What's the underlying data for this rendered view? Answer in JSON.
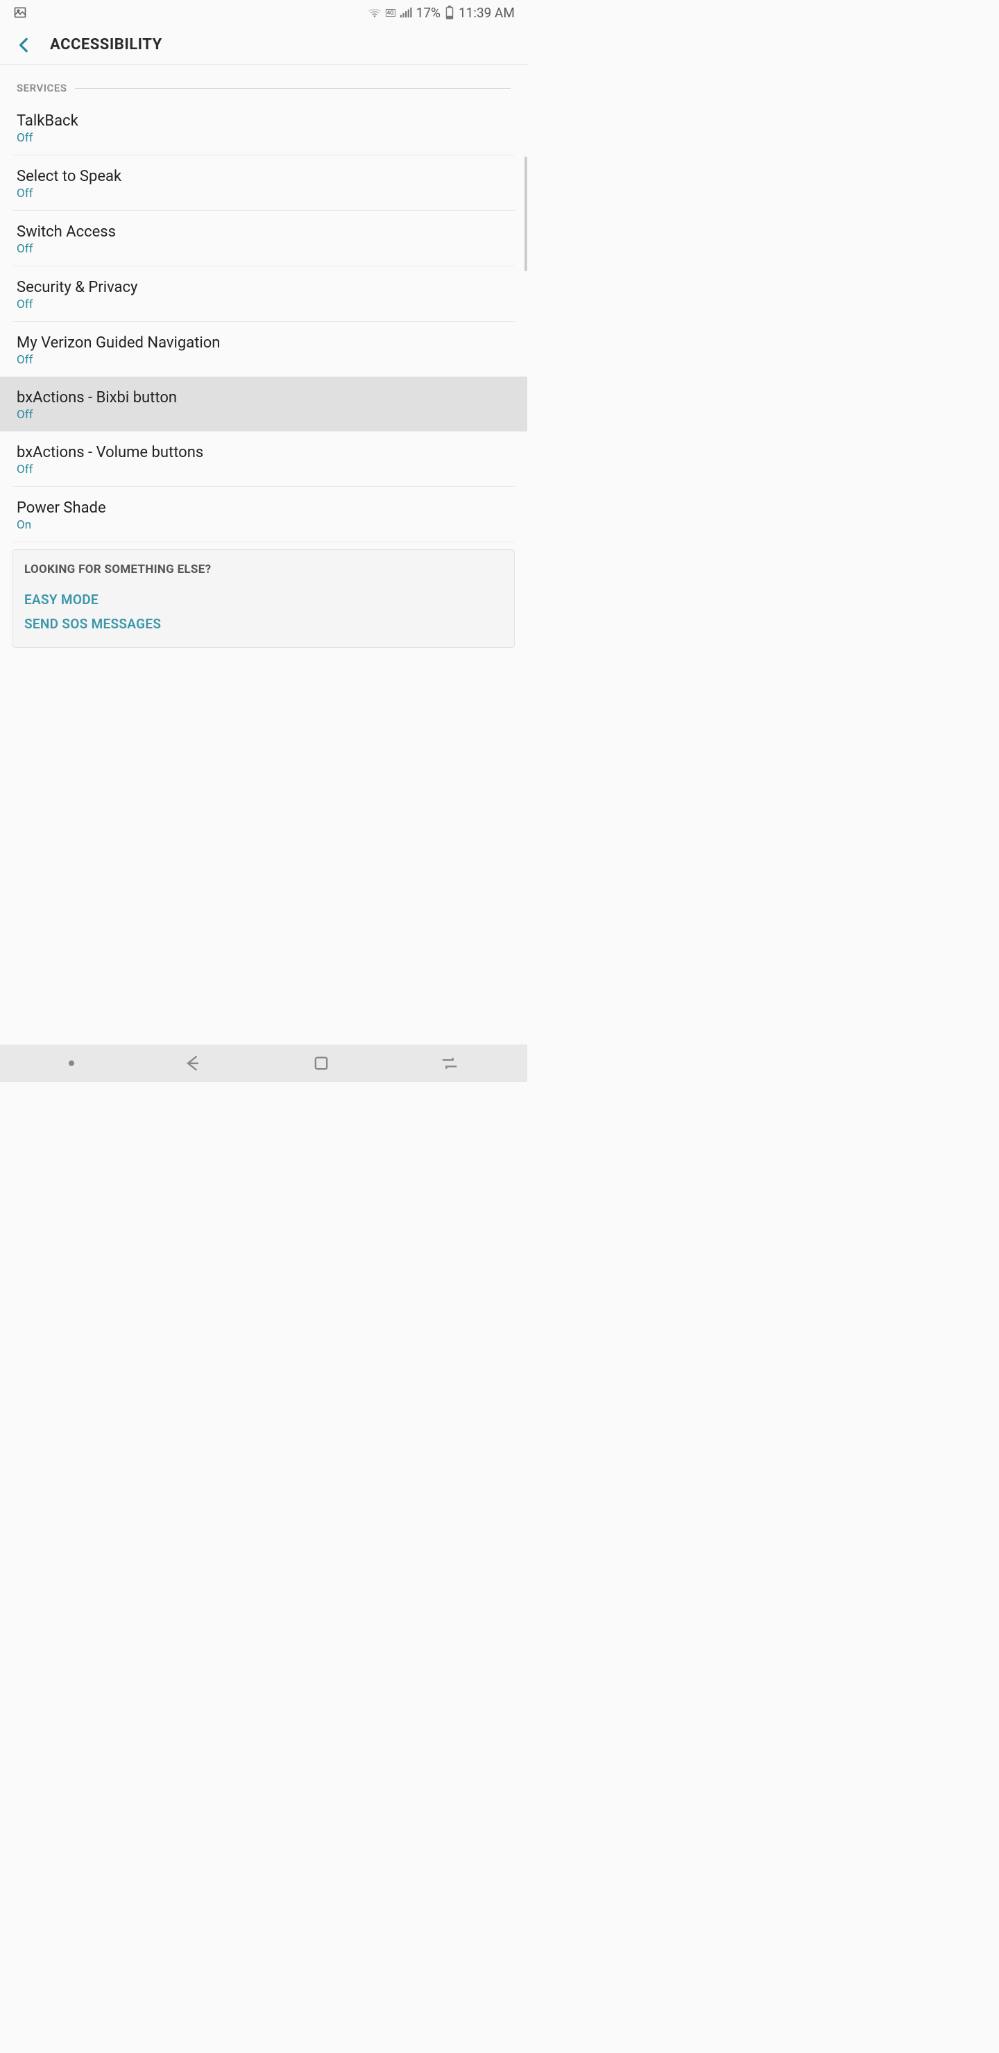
{
  "status": {
    "battery_pct": "17%",
    "time": "11:39 AM"
  },
  "header": {
    "title": "ACCESSIBILITY"
  },
  "section": {
    "label": "SERVICES"
  },
  "items": [
    {
      "title": "TalkBack",
      "status": "Off",
      "highlighted": false
    },
    {
      "title": "Select to Speak",
      "status": "Off",
      "highlighted": false
    },
    {
      "title": "Switch Access",
      "status": "Off",
      "highlighted": false
    },
    {
      "title": "Security & Privacy",
      "status": "Off",
      "highlighted": false
    },
    {
      "title": "My Verizon Guided Navigation",
      "status": "Off",
      "highlighted": false
    },
    {
      "title": "bxActions - Bixbi button",
      "status": "Off",
      "highlighted": true
    },
    {
      "title": "bxActions - Volume buttons",
      "status": "Off",
      "highlighted": false
    },
    {
      "title": "Power Shade",
      "status": "On",
      "highlighted": false
    }
  ],
  "related": {
    "title": "LOOKING FOR SOMETHING ELSE?",
    "links": [
      "EASY MODE",
      "SEND SOS MESSAGES"
    ]
  }
}
